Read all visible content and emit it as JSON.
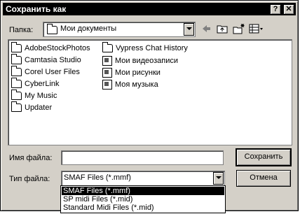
{
  "window": {
    "title": "Сохранить как"
  },
  "titlebar": {
    "help_label": "?",
    "close_label": "✕"
  },
  "location": {
    "label": "Папка:",
    "value": "Мои документы"
  },
  "files": [
    {
      "name": "AdobeStockPhotos",
      "icon": "folder-icon"
    },
    {
      "name": "Camtasia Studio",
      "icon": "folder-icon"
    },
    {
      "name": "Corel User Files",
      "icon": "folder-icon"
    },
    {
      "name": "CyberLink",
      "icon": "folder-icon"
    },
    {
      "name": "My Music",
      "icon": "folder-icon"
    },
    {
      "name": "Updater",
      "icon": "folder-icon"
    },
    {
      "name": "Vypress Chat History",
      "icon": "folder-icon"
    },
    {
      "name": "Мои видеозаписи",
      "icon": "video-folder-icon"
    },
    {
      "name": "Мои рисунки",
      "icon": "pictures-folder-icon"
    },
    {
      "name": "Моя музыка",
      "icon": "music-folder-icon"
    }
  ],
  "filename": {
    "label": "Имя файла:",
    "value": ""
  },
  "filetype": {
    "label": "Тип файла:",
    "selected": "SMAF Files (*.mmf)",
    "options": [
      "SMAF Files (*.mmf)",
      "SP midi Files (*.mid)",
      "Standard Midi Files (*.mid)"
    ]
  },
  "buttons": {
    "save": "Сохранить",
    "cancel": "Отмена"
  }
}
